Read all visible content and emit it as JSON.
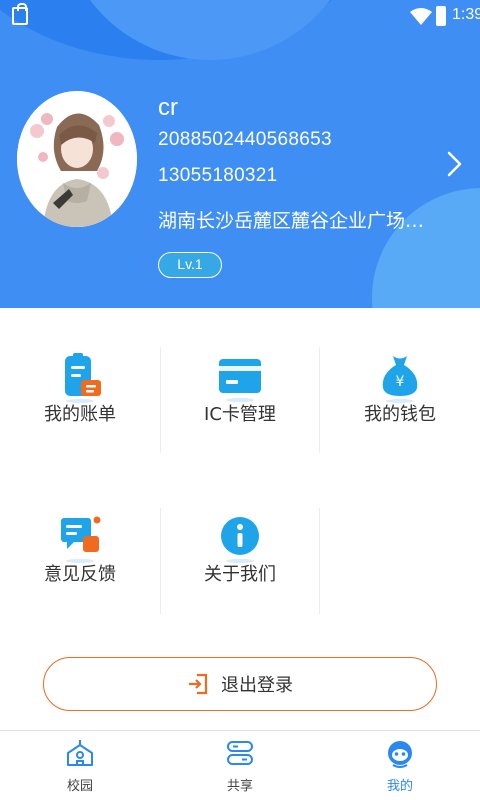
{
  "status_bar": {
    "time": "1:39"
  },
  "profile": {
    "name": "cr",
    "id": "2088502440568653",
    "phone": "13055180321",
    "address": "湖南长沙岳麓区麓谷企业广场…",
    "level": "Lv.1"
  },
  "menu": {
    "items": [
      {
        "label": "我的账单",
        "icon": "bill-icon"
      },
      {
        "label": "IC卡管理",
        "icon": "card-icon"
      },
      {
        "label": "我的钱包",
        "icon": "money-bag-icon"
      },
      {
        "label": "意见反馈",
        "icon": "feedback-icon"
      },
      {
        "label": "关于我们",
        "icon": "info-icon"
      }
    ]
  },
  "logout": {
    "label": "退出登录"
  },
  "bottom_nav": {
    "items": [
      {
        "label": "校园",
        "icon": "campus-icon"
      },
      {
        "label": "共享",
        "icon": "share-icon"
      },
      {
        "label": "我的",
        "icon": "mine-icon",
        "active": true
      }
    ]
  },
  "colors": {
    "primary": "#3f8ef4",
    "accent": "#f06a1f",
    "active_tab": "#2b88f0",
    "icon_blue": "#1fa4ea"
  }
}
